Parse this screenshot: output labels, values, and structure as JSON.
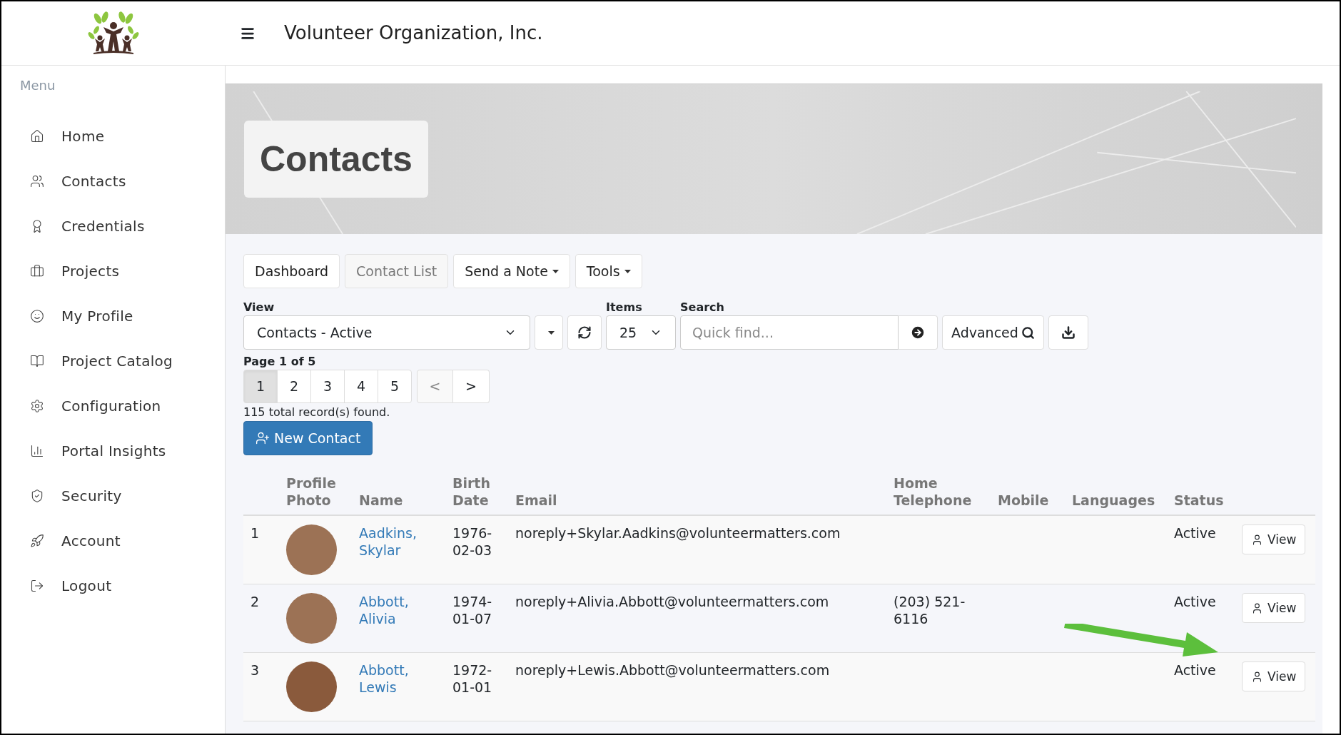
{
  "header": {
    "title": "Volunteer Organization, Inc."
  },
  "sidebar": {
    "heading": "Menu",
    "items": [
      {
        "label": "Home"
      },
      {
        "label": "Contacts"
      },
      {
        "label": "Credentials"
      },
      {
        "label": "Projects"
      },
      {
        "label": "My Profile"
      },
      {
        "label": "Project Catalog"
      },
      {
        "label": "Configuration"
      },
      {
        "label": "Portal Insights"
      },
      {
        "label": "Security"
      },
      {
        "label": "Account"
      },
      {
        "label": "Logout"
      }
    ]
  },
  "page_title": "Contacts",
  "tabs": [
    {
      "label": "Dashboard",
      "selected": false,
      "kind": "button"
    },
    {
      "label": "Contact List",
      "selected": true,
      "kind": "button"
    },
    {
      "label": "Send a Note",
      "selected": false,
      "kind": "dropdown"
    },
    {
      "label": "Tools",
      "selected": false,
      "kind": "dropdown"
    }
  ],
  "filters": {
    "view": {
      "label": "View",
      "value": "Contacts - Active"
    },
    "items": {
      "label": "Items",
      "value": "25"
    },
    "search": {
      "label": "Search",
      "placeholder": "Quick find..."
    },
    "advanced_button": "Advanced"
  },
  "pagination": {
    "label": "Page 1 of 5",
    "pages": [
      {
        "label": "1",
        "selected": true
      },
      {
        "label": "2",
        "selected": false
      },
      {
        "label": "3",
        "selected": false
      },
      {
        "label": "4",
        "selected": false
      },
      {
        "label": "5",
        "selected": false
      }
    ],
    "prev": "<",
    "next": ">",
    "record_count": "115 total record(s) found."
  },
  "new_button": "New Contact",
  "table": {
    "columns": [
      "Profile Photo",
      "Name",
      "Birth Date",
      "Email",
      "Home Telephone",
      "Mobile",
      "Languages",
      "Status"
    ],
    "rows": [
      {
        "number": "1",
        "name": "Aadkins, Skylar",
        "birth_date": "1976-02-03",
        "email": "noreply+Skylar.Aadkins@volunteermatters.com",
        "status": "Active",
        "action": "View"
      },
      {
        "number": "2",
        "name": "Abbott, Alivia",
        "birth_date": "1974-01-07",
        "email": "noreply+Alivia.Abbott@volunteermatters.com",
        "home_telephone": "(203) 521-6116",
        "status": "Active",
        "action": "View"
      },
      {
        "number": "3",
        "name": "Abbott, Lewis",
        "birth_date": "1972-01-01",
        "email": "noreply+Lewis.Abbott@volunteermatters.com",
        "status": "Active",
        "action": "View"
      }
    ]
  }
}
